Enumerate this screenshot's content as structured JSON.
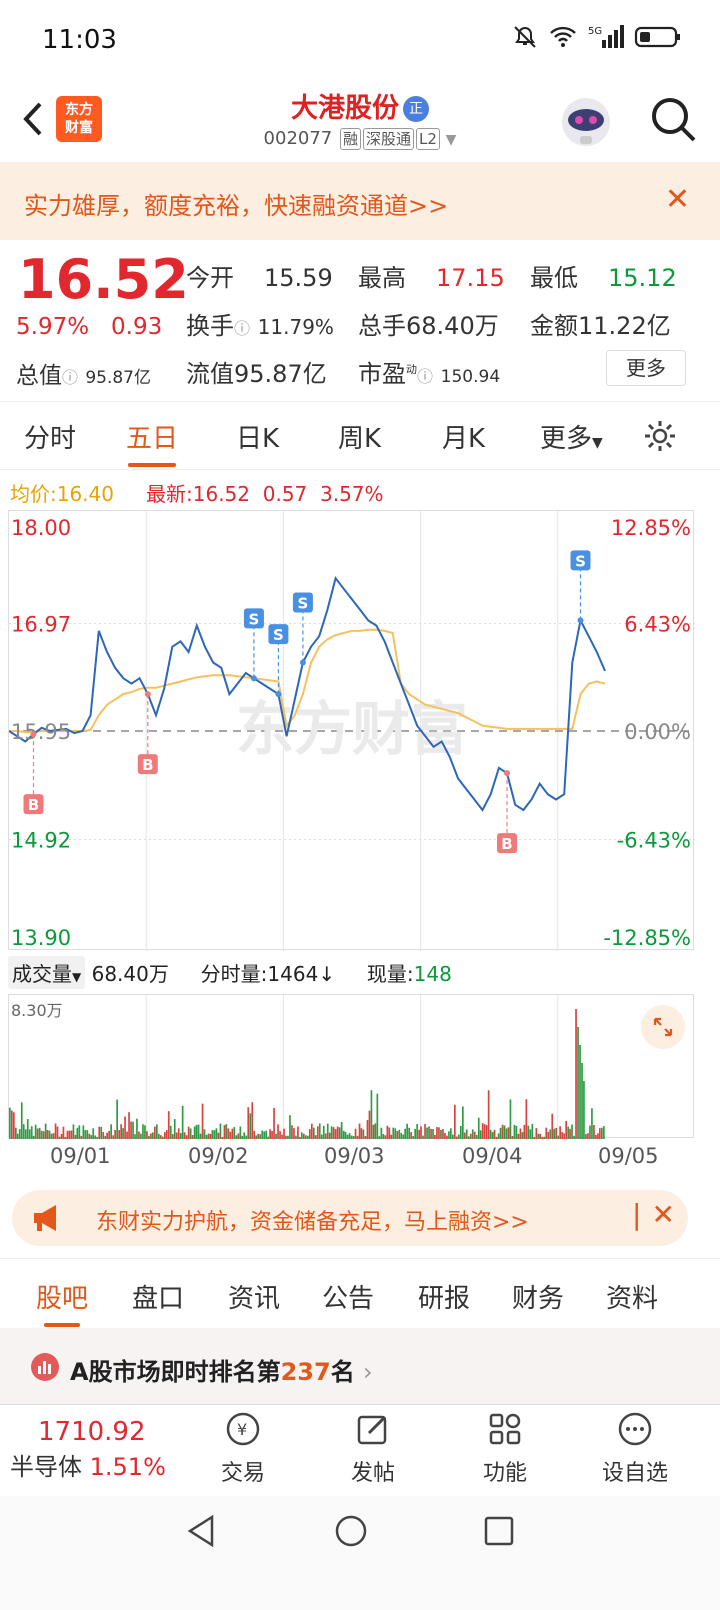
{
  "status": {
    "time": "11:03",
    "network": "5G"
  },
  "header": {
    "logo_line1": "东方",
    "logo_line2": "财富",
    "title": "大港股份",
    "title_badge": "正",
    "code": "002077",
    "tags": [
      "融",
      "深股通",
      "L2"
    ]
  },
  "banner1": {
    "text": "实力雄厚，额度充裕，快速融资通道>>",
    "close": "✕"
  },
  "quote": {
    "price": "16.52",
    "pct": "5.97%",
    "change": "0.93",
    "open_label": "今开",
    "open": "15.59",
    "high_label": "最高",
    "high": "17.15",
    "low_label": "最低",
    "low": "15.12",
    "turnover_label": "换手",
    "turnover": "11.79%",
    "volume_label": "总手",
    "volume": "68.40万",
    "amount_label": "金额",
    "amount": "11.22亿",
    "mktcap_label": "总值",
    "mktcap": "95.87亿",
    "float_label": "流值",
    "float": "95.87亿",
    "pe_label": "市盈",
    "pe_sup": "动",
    "pe": "150.94",
    "more": "更多"
  },
  "tabs": [
    "分时",
    "五日",
    "日K",
    "周K",
    "月K",
    "更多"
  ],
  "avgline": {
    "avg_label": "均价:",
    "avg": "16.40",
    "latest_label": "最新:",
    "latest": "16.52",
    "diff": "0.57",
    "diff_pct": "3.57%"
  },
  "chart_data": {
    "type": "line",
    "ylim": [
      13.9,
      18.0
    ],
    "y_ticks_left": [
      "18.00",
      "16.97",
      "15.95",
      "14.92",
      "13.90"
    ],
    "y_ticks_right": [
      "12.85%",
      "6.43%",
      "0.00%",
      "-6.43%",
      "-12.85%"
    ],
    "x_categories": [
      "09/01",
      "09/02",
      "09/03",
      "09/04",
      "09/05"
    ],
    "series": [
      {
        "values": [
          15.95,
          15.9,
          15.85,
          15.92,
          15.98,
          15.95,
          15.96,
          15.97,
          15.93,
          15.95,
          16.1,
          16.9,
          16.7,
          16.55,
          16.45,
          16.4,
          16.45,
          16.3,
          16.1,
          16.35,
          16.75,
          16.8,
          16.7,
          16.95,
          16.75,
          16.6,
          16.55,
          16.3,
          16.4,
          16.5,
          16.45,
          16.4,
          16.35,
          16.3,
          15.9,
          16.25,
          16.6,
          16.75,
          16.85,
          17.1,
          17.4,
          17.3,
          17.2,
          17.1,
          17.0,
          16.95,
          16.8,
          16.6,
          16.4,
          16.2,
          16.0,
          15.9,
          15.8,
          15.85,
          15.7,
          15.5,
          15.4,
          15.3,
          15.2,
          15.35,
          15.6,
          15.55,
          15.25,
          15.2,
          15.3,
          15.45,
          15.35,
          15.3,
          15.35,
          16.6,
          17.0,
          16.85,
          16.7,
          16.52
        ]
      },
      {
        "values": [
          15.95,
          15.95,
          15.94,
          15.94,
          15.95,
          15.95,
          15.95,
          15.95,
          15.95,
          15.95,
          15.96,
          16.1,
          16.2,
          16.25,
          16.3,
          16.32,
          16.35,
          16.36,
          16.36,
          16.38,
          16.4,
          16.42,
          16.44,
          16.46,
          16.47,
          16.48,
          16.48,
          16.48,
          16.47,
          16.46,
          16.45,
          16.44,
          16.43,
          16.42,
          16.0,
          16.1,
          16.3,
          16.6,
          16.75,
          16.82,
          16.86,
          16.88,
          16.9,
          16.9,
          16.91,
          16.91,
          16.9,
          16.88,
          16.4,
          16.3,
          16.25,
          16.2,
          16.18,
          16.16,
          16.14,
          16.12,
          16.08,
          16.04,
          16.0,
          15.99,
          15.98,
          15.97,
          15.97,
          15.97,
          15.97,
          15.97,
          15.97,
          15.97,
          15.97,
          15.97,
          16.3,
          16.4,
          16.42,
          16.4
        ]
      }
    ]
  },
  "markers": {
    "B": "B",
    "S": "S"
  },
  "watermark": "东方财富",
  "volinfo": {
    "label": "成交量",
    "total": "68.40万",
    "fen_label": "分时量:",
    "fen": "1464",
    "fen_arrow": "↓",
    "now_label": "现量:",
    "now": "148",
    "max": "8.30万"
  },
  "banner2": {
    "text": "东财实力护航，资金储备充足，马上融资>>",
    "close": "✕"
  },
  "btabs": [
    "股吧",
    "盘口",
    "资讯",
    "公告",
    "研报",
    "财务",
    "资料"
  ],
  "rank": {
    "prefix": "A股市场即时排名第",
    "num": "237",
    "suffix": "名"
  },
  "bottom": {
    "index_val": "1710.92",
    "index_name": "半导体",
    "index_pct": "1.51%",
    "items": [
      "交易",
      "发帖",
      "功能",
      "设自选"
    ]
  }
}
